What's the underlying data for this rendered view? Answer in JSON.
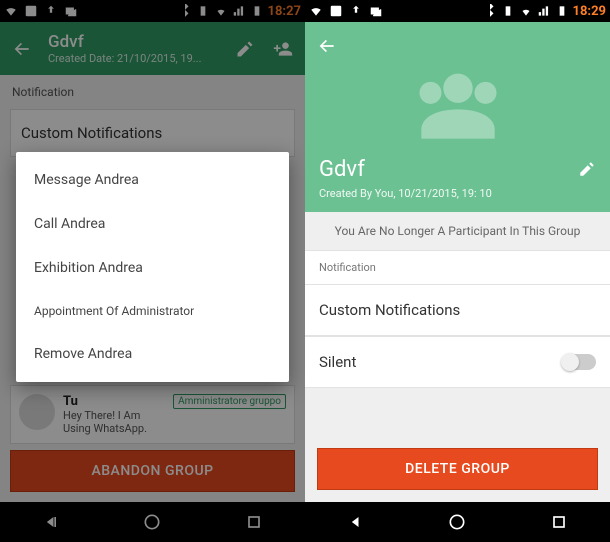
{
  "statusbar": {
    "time_left": "18:27",
    "time_right": "18:29"
  },
  "left": {
    "header": {
      "title": "Gdvf",
      "subtitle": "Created Date: 21/10/2015, 19..."
    },
    "notif_label": "Notification",
    "custom": "Custom Notifications",
    "member": {
      "name": "Tu",
      "status": "Hey There! I Am Using WhatsApp.",
      "badge": "Amministratore gruppo"
    },
    "abandon": "ABANDON GROUP",
    "popup": {
      "i0": "Message Andrea",
      "i1": "Call Andrea",
      "i2": "Exhibition Andrea",
      "i3": "Appointment Of Administrator",
      "i4": "Remove Andrea"
    }
  },
  "right": {
    "header": {
      "title": "Gdvf",
      "subtitle": "Created By You, 10/21/2015, 19: 10"
    },
    "notice": "You Are No Longer A Participant In This Group",
    "notif_label": "Notification",
    "custom": "Custom Notifications",
    "silent": "Silent",
    "delete": "DELETE GROUP"
  }
}
